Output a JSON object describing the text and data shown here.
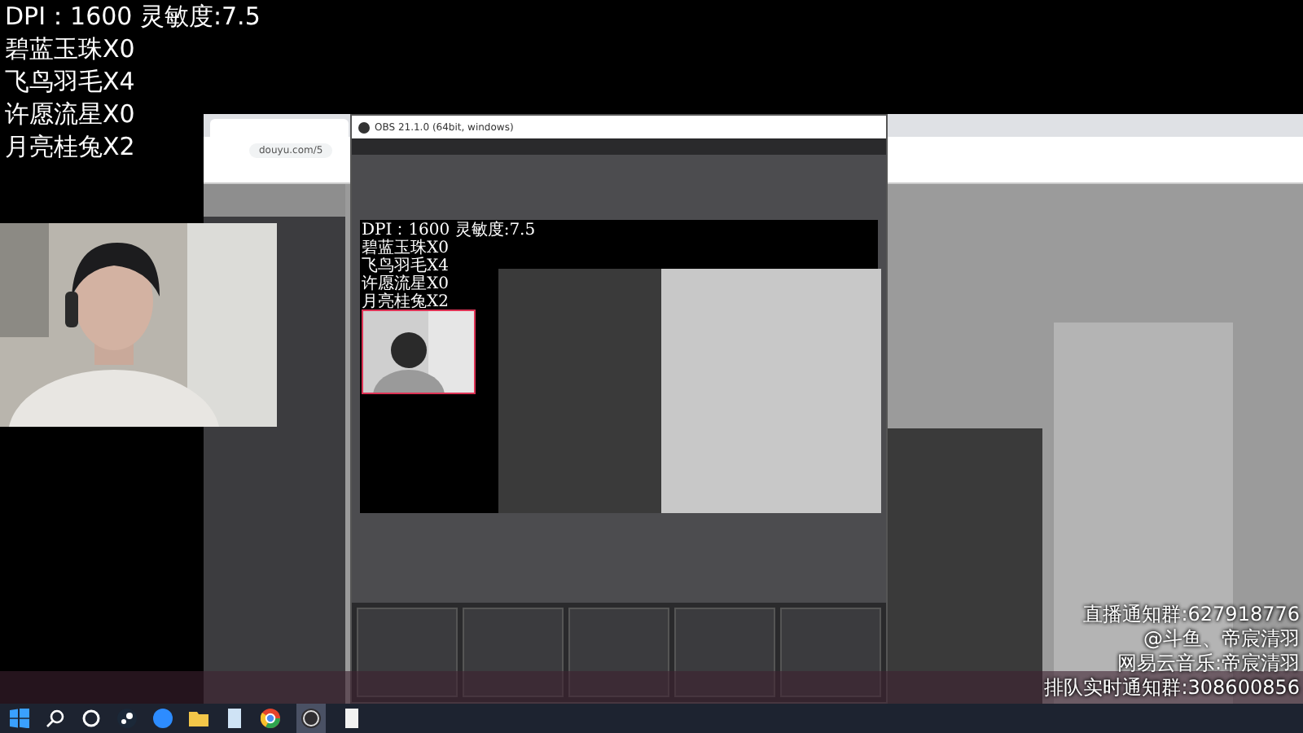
{
  "overlay": {
    "lines": [
      "DPI：1600 灵敏度:7.5",
      "碧蓝玉珠X0",
      "飞鸟羽毛X4",
      "许愿流星X0",
      "月亮桂兔X2"
    ]
  },
  "browser": {
    "url": "douyu.com/5"
  },
  "obs": {
    "title": "OBS 21.1.0 (64bit, windows)",
    "preview_lines": [
      "DPI：1600 灵敏度:7.5",
      "碧蓝玉珠X0",
      "飞鸟羽毛X4",
      "许愿流星X0",
      "月亮桂兔X2"
    ]
  },
  "info_lines": [
    "直播通知群:627918776",
    "@斗鱼、帝宸清羽",
    "网易云音乐:帝宸清羽",
    "排队实时通知群:308600856"
  ]
}
